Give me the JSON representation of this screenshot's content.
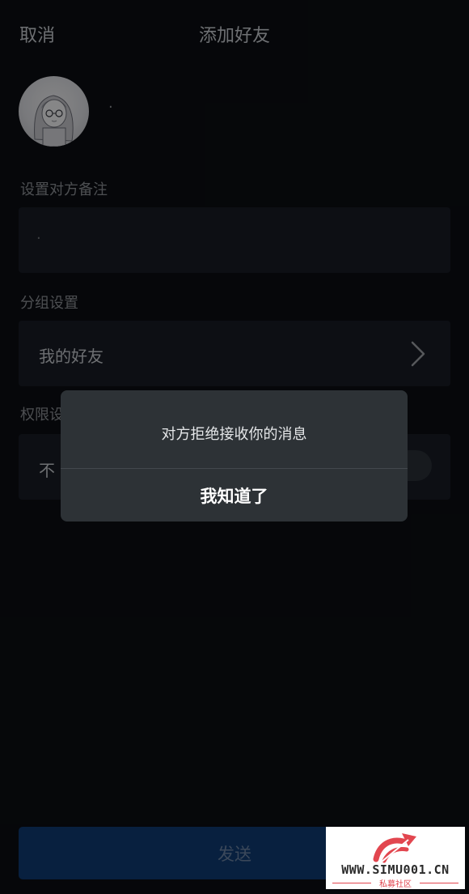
{
  "header": {
    "cancel_label": "取消",
    "title": "添加好友"
  },
  "profile": {
    "avatar_icon": "anime-girl-avatar",
    "name": "·"
  },
  "remark": {
    "section_label": "设置对方备注",
    "value": "·"
  },
  "group": {
    "section_label": "分组设置",
    "value": "我的好友",
    "icon": "chevron-right-icon"
  },
  "permission": {
    "section_label": "权限设",
    "value": "不",
    "toggle_on": false
  },
  "dialog": {
    "message": "对方拒绝接收你的消息",
    "button_label": "我知道了"
  },
  "footer": {
    "send_label": "发送"
  },
  "watermark": {
    "url": "WWW.SIMU001.CN",
    "subtitle": "私募社区"
  },
  "colors": {
    "background": "#0b0e13",
    "card": "#181d25",
    "dialog": "#2d3236",
    "send_button": "#0f3b73",
    "watermark_red": "#e2464f"
  }
}
